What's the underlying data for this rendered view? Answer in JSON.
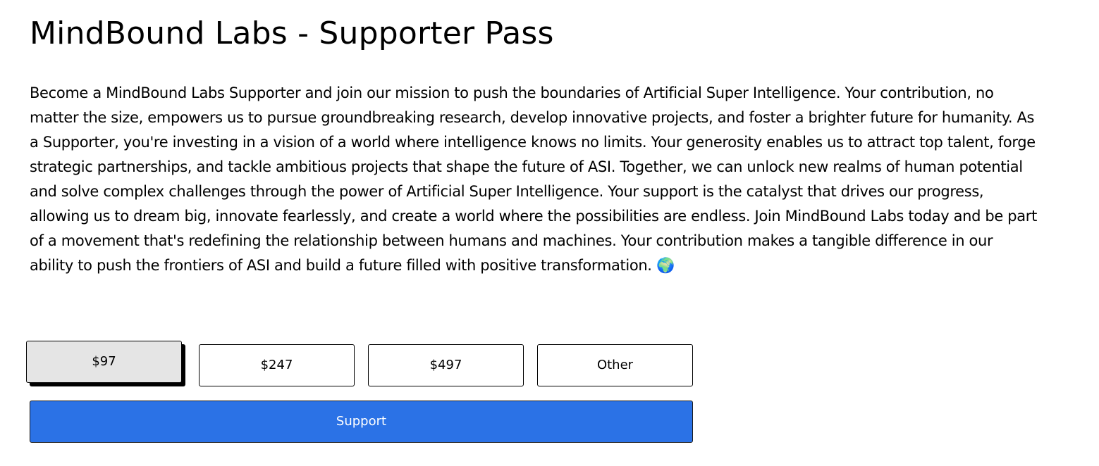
{
  "page": {
    "title": "MindBound Labs - Supporter Pass",
    "description": "Become a MindBound Labs Supporter and join our mission to push the boundaries of Artificial Super Intelligence. Your contribution, no matter the size, empowers us to pursue groundbreaking research, develop innovative projects, and foster a brighter future for humanity. As a Supporter, you're investing in a vision of a world where intelligence knows no limits. Your generosity enables us to attract top talent, forge strategic partnerships, and tackle ambitious projects that shape the future of ASI. Together, we can unlock new realms of human potential and solve complex challenges through the power of Artificial Super Intelligence. Your support is the catalyst that drives our progress, allowing us to dream big, innovate fearlessly, and create a world where the possibilities are endless. Join MindBound Labs today and be part of a movement that's redefining the relationship between humans and machines. Your contribution makes a tangible difference in our ability to push the frontiers of ASI and build a future filled with positive transformation. 🌍"
  },
  "amounts": {
    "options": [
      {
        "label": "$97",
        "selected": true
      },
      {
        "label": "$247",
        "selected": false
      },
      {
        "label": "$497",
        "selected": false
      },
      {
        "label": "Other",
        "selected": false
      }
    ]
  },
  "actions": {
    "support_label": "Support",
    "support_color": "#2b72e6"
  }
}
